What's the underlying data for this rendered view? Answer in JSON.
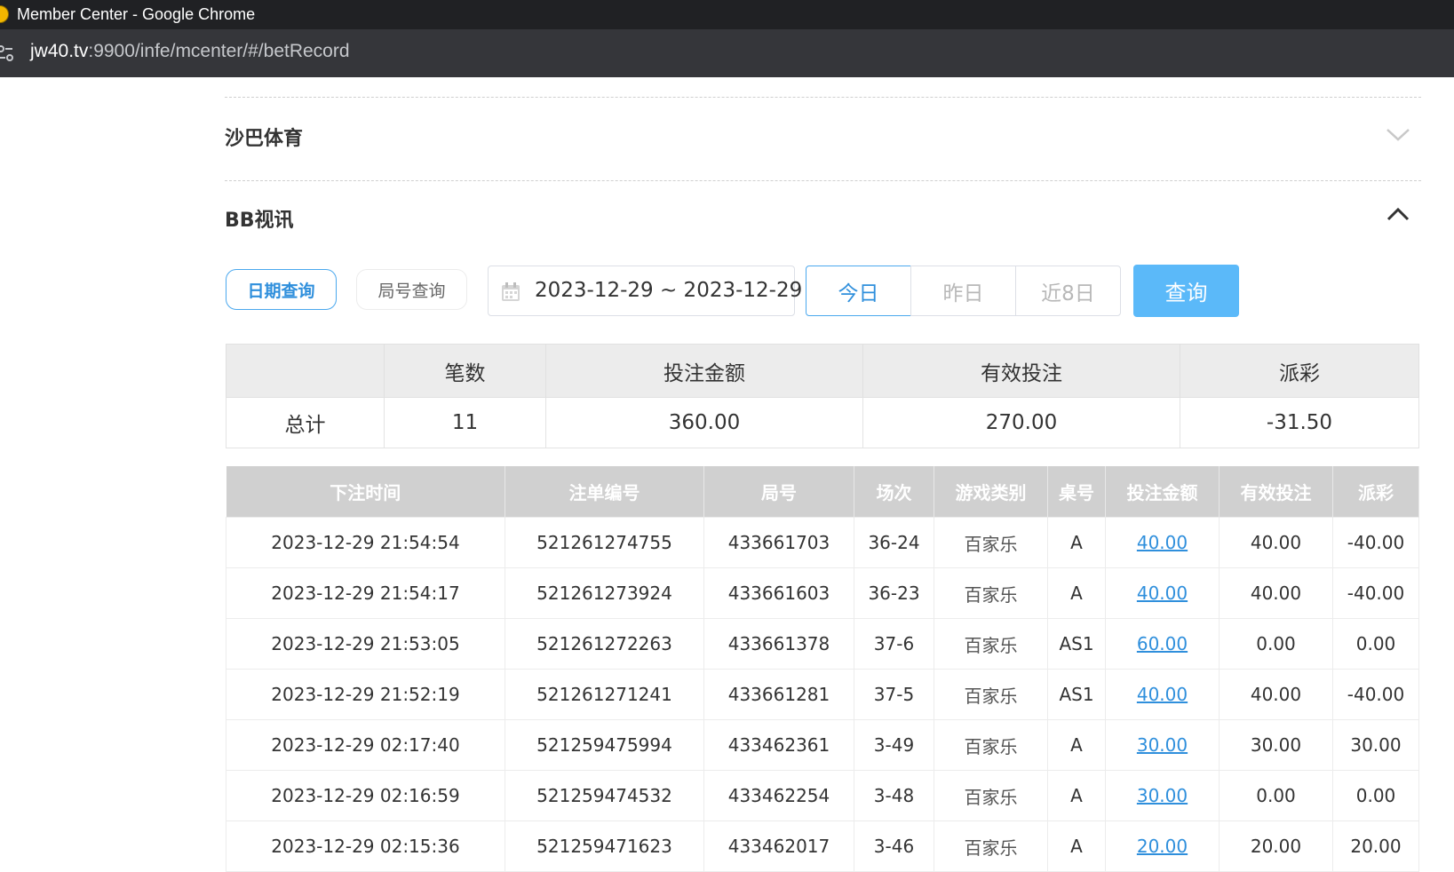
{
  "browser": {
    "window_title": "Member Center - Google Chrome",
    "url_host": "jw40.tv",
    "url_path": ":9900/infe/mcenter/#/betRecord"
  },
  "sections": {
    "saba": {
      "title": "沙巴体育",
      "icon": "chevron-down-icon"
    },
    "bb": {
      "title": "BB视讯",
      "icon": "chevron-up-icon"
    }
  },
  "filters": {
    "tab_date": "日期查询",
    "tab_round": "局号查询",
    "date_range": "2023-12-29 ~ 2023-12-29",
    "today": "今日",
    "yesterday": "昨日",
    "last8": "近8日",
    "query": "查询"
  },
  "summary": {
    "headers": [
      "",
      "笔数",
      "投注金额",
      "有效投注",
      "派彩"
    ],
    "row": {
      "label": "总计",
      "count": "11",
      "bet": "360.00",
      "valid": "270.00",
      "payout": "-31.50"
    }
  },
  "records": {
    "headers": [
      "下注时间",
      "注单编号",
      "局号",
      "场次",
      "游戏类别",
      "桌号",
      "投注金额",
      "有效投注",
      "派彩"
    ],
    "rows": [
      {
        "time": "2023-12-29 21:54:54",
        "order": "521261274755",
        "round": "433661703",
        "session": "36-24",
        "game": "百家乐",
        "table": "A",
        "bet": "40.00",
        "valid": "40.00",
        "payout": "-40.00"
      },
      {
        "time": "2023-12-29 21:54:17",
        "order": "521261273924",
        "round": "433661603",
        "session": "36-23",
        "game": "百家乐",
        "table": "A",
        "bet": "40.00",
        "valid": "40.00",
        "payout": "-40.00"
      },
      {
        "time": "2023-12-29 21:53:05",
        "order": "521261272263",
        "round": "433661378",
        "session": "37-6",
        "game": "百家乐",
        "table": "AS1",
        "bet": "60.00",
        "valid": "0.00",
        "payout": "0.00"
      },
      {
        "time": "2023-12-29 21:52:19",
        "order": "521261271241",
        "round": "433661281",
        "session": "37-5",
        "game": "百家乐",
        "table": "AS1",
        "bet": "40.00",
        "valid": "40.00",
        "payout": "-40.00"
      },
      {
        "time": "2023-12-29 02:17:40",
        "order": "521259475994",
        "round": "433462361",
        "session": "3-49",
        "game": "百家乐",
        "table": "A",
        "bet": "30.00",
        "valid": "30.00",
        "payout": "30.00"
      },
      {
        "time": "2023-12-29 02:16:59",
        "order": "521259474532",
        "round": "433462254",
        "session": "3-48",
        "game": "百家乐",
        "table": "A",
        "bet": "30.00",
        "valid": "0.00",
        "payout": "0.00"
      },
      {
        "time": "2023-12-29 02:15:36",
        "order": "521259471623",
        "round": "433462017",
        "session": "3-46",
        "game": "百家乐",
        "table": "A",
        "bet": "20.00",
        "valid": "20.00",
        "payout": "20.00"
      }
    ]
  },
  "colors": {
    "accent": "#2f8fdc",
    "query_button": "#5bb9f9",
    "negative": "#e0312f"
  }
}
